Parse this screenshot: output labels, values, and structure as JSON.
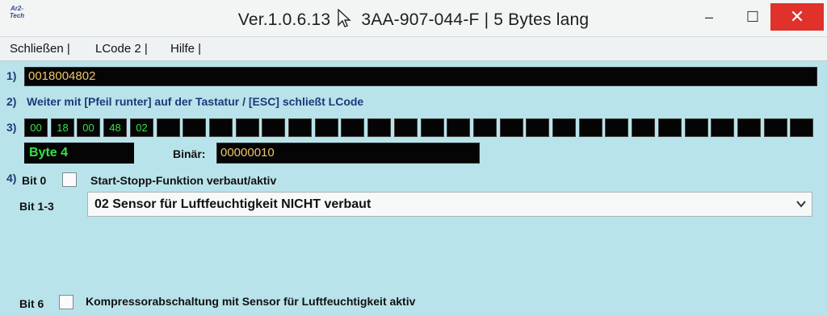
{
  "window": {
    "logo_text": "Ar2-Tech",
    "title": "Ver.1.0.6.13",
    "subtitle": "3AA-907-044-F | 5 Bytes lang",
    "minimize_glyph": "–",
    "maximize_glyph": "☐",
    "close_glyph": "✕"
  },
  "menu": {
    "items": [
      {
        "label": "Schließen |"
      },
      {
        "label": "LCode 2 |"
      },
      {
        "label": "Hilfe |"
      }
    ]
  },
  "row1": {
    "label": "1)",
    "code": "0018004802"
  },
  "row2": {
    "label": "2)",
    "instruction": "Weiter mit [Pfeil runter] auf der Tastatur / [ESC] schließt LCode"
  },
  "row3": {
    "label": "3)",
    "bytes": [
      "00",
      "18",
      "00",
      "48",
      "02",
      "",
      "",
      "",
      "",
      "",
      "",
      "",
      "",
      "",
      "",
      "",
      "",
      "",
      "",
      "",
      "",
      "",
      "",
      "",
      "",
      "",
      "",
      "",
      "",
      ""
    ]
  },
  "byte_info": {
    "selected": "Byte 4",
    "binar_label": "Binär:",
    "binar_value": "00000010"
  },
  "section4": {
    "label": "4)",
    "bit0": {
      "label": "Bit 0",
      "text": "Start-Stopp-Funktion verbaut/aktiv",
      "checked": false
    },
    "bit13": {
      "label": "Bit 1-3",
      "selected": "02 Sensor für Luftfeuchtigkeit NICHT verbaut"
    },
    "bit6": {
      "label": "Bit 6",
      "text": "Kompressorabschaltung mit Sensor für Luftfeuchtigkeit aktiv",
      "checked": false
    }
  },
  "icons": {
    "cursor": "mouse-pointer-icon",
    "dropdown": "chevron-down-icon"
  }
}
